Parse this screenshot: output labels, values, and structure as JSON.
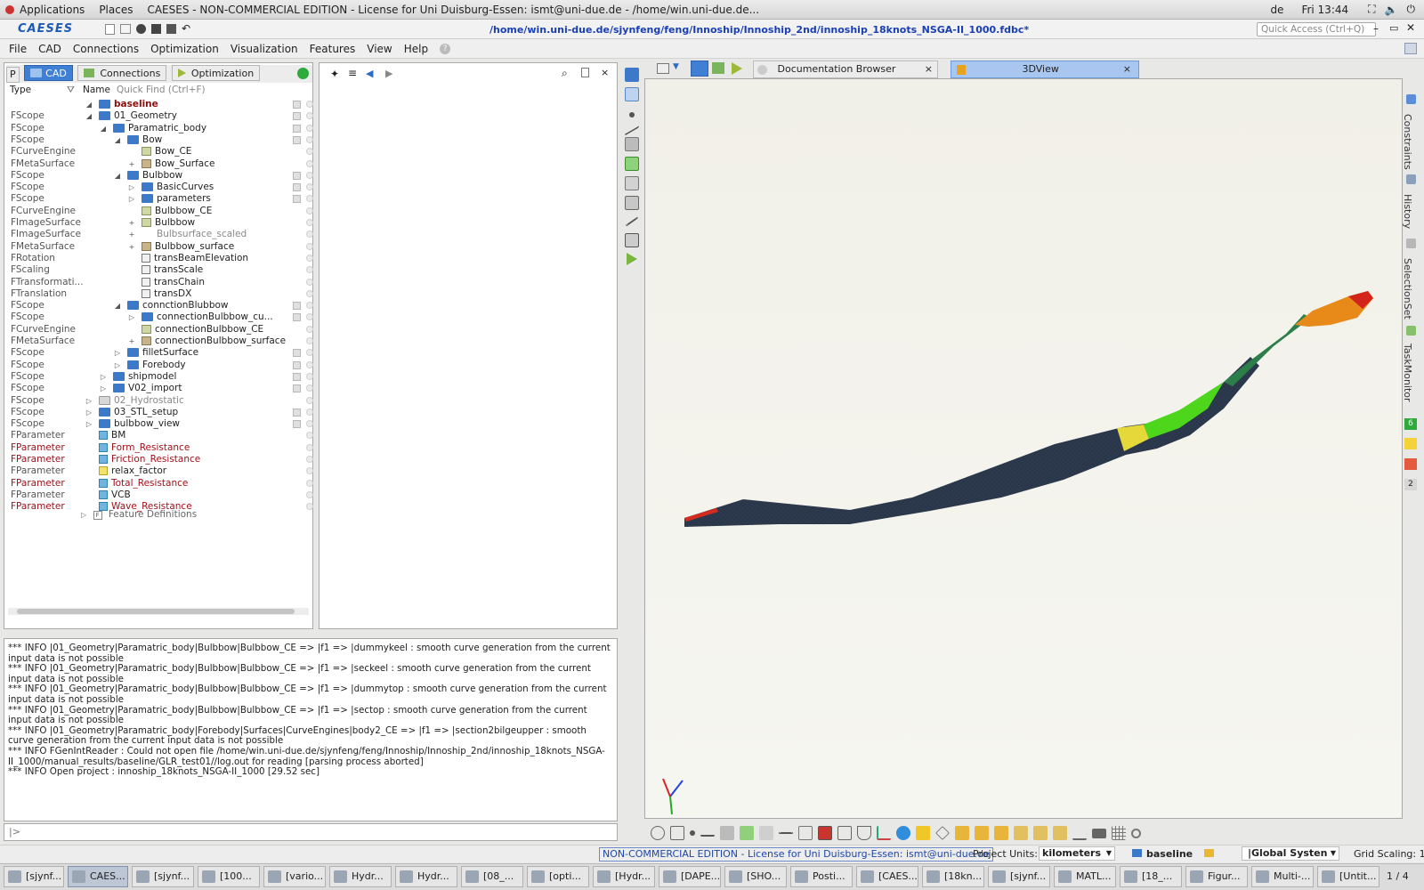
{
  "topbar": {
    "applications": "Applications",
    "places": "Places",
    "window_title": "CAESES - NON-COMMERCIAL EDITION - License for Uni Duisburg-Essen: ismt@uni-due.de - /home/win.uni-due.de...",
    "keyboard": "de",
    "clock": "Fri 13:44"
  },
  "app": {
    "logo": "CAESES",
    "file_path": "/home/win.uni-due.de/sjynfeng/feng/Innoship/Innoship_2nd/innoship_18knots_NSGA-II_1000.fdbc*",
    "quick_access_placeholder": "Quick Access (Ctrl+Q)"
  },
  "menu": [
    "File",
    "CAD",
    "Connections",
    "Optimization",
    "Visualization",
    "Features",
    "View",
    "Help"
  ],
  "left_tabs": {
    "p": "P",
    "cad": "CAD",
    "connections": "Connections",
    "optimization": "Optimization"
  },
  "tree_header": {
    "type": "Type",
    "name": "Name",
    "quickfind_placeholder": "Quick Find (Ctrl+F)"
  },
  "tree": [
    {
      "type": "",
      "name": "baseline",
      "style": "bold",
      "indent": 110,
      "fold": "◢",
      "icon": "folder"
    },
    {
      "type": "FScope",
      "name": "01_Geometry",
      "indent": 110,
      "fold": "◢",
      "icon": "folder"
    },
    {
      "type": "FScope",
      "name": "Paramatric_body",
      "indent": 126,
      "fold": "◢",
      "icon": "folder"
    },
    {
      "type": "FScope",
      "name": "Bow",
      "indent": 142,
      "fold": "◢",
      "icon": "folder"
    },
    {
      "type": "FCurveEngine",
      "name": "Bow_CE",
      "indent": 158,
      "fold": "",
      "icon": "curve"
    },
    {
      "type": "FMetaSurface",
      "name": "Bow_Surface",
      "indent": 158,
      "fold": "+",
      "icon": "surf"
    },
    {
      "type": "FScope",
      "name": "Bulbbow",
      "indent": 142,
      "fold": "◢",
      "icon": "folder"
    },
    {
      "type": "FScope",
      "name": "BasicCurves",
      "indent": 158,
      "fold": "▷",
      "icon": "folder"
    },
    {
      "type": "FScope",
      "name": "parameters",
      "indent": 158,
      "fold": "▷",
      "icon": "folder"
    },
    {
      "type": "FCurveEngine",
      "name": "Bulbbow_CE",
      "indent": 158,
      "fold": "",
      "icon": "curve"
    },
    {
      "type": "FImageSurface",
      "name": "Bulbbow",
      "indent": 158,
      "fold": "+",
      "icon": "curve"
    },
    {
      "type": "FImageSurface",
      "name": "Bulbsurface_scaled",
      "style": "grey",
      "indent": 158,
      "fold": "+",
      "icon": "none"
    },
    {
      "type": "FMetaSurface",
      "name": "Bulbbow_surface",
      "indent": 158,
      "fold": "+",
      "icon": "surf"
    },
    {
      "type": "FRotation",
      "name": "transBeamElevation",
      "indent": 158,
      "fold": "",
      "icon": "transf"
    },
    {
      "type": "FScaling",
      "name": "transScale",
      "indent": 158,
      "fold": "",
      "icon": "transf"
    },
    {
      "type": "FTransformati...",
      "name": "transChain",
      "indent": 158,
      "fold": "",
      "icon": "transf"
    },
    {
      "type": "FTranslation",
      "name": "transDX",
      "indent": 158,
      "fold": "",
      "icon": "transf"
    },
    {
      "type": "FScope",
      "name": "connctionBlubbow",
      "indent": 142,
      "fold": "◢",
      "icon": "folder"
    },
    {
      "type": "FScope",
      "name": "connectionBulbbow_cu...",
      "indent": 158,
      "fold": "▷",
      "icon": "folder"
    },
    {
      "type": "FCurveEngine",
      "name": "connectionBulbbow_CE",
      "indent": 158,
      "fold": "",
      "icon": "curve"
    },
    {
      "type": "FMetaSurface",
      "name": "connectionBulbbow_surface",
      "indent": 158,
      "fold": "+",
      "icon": "surf"
    },
    {
      "type": "FScope",
      "name": "filletSurface",
      "indent": 142,
      "fold": "▷",
      "icon": "folder"
    },
    {
      "type": "FScope",
      "name": "Forebody",
      "indent": 142,
      "fold": "▷",
      "icon": "folder"
    },
    {
      "type": "FScope",
      "name": "shipmodel",
      "indent": 126,
      "fold": "▷",
      "icon": "folder"
    },
    {
      "type": "FScope",
      "name": "V02_import",
      "indent": 126,
      "fold": "▷",
      "icon": "folder"
    },
    {
      "type": "FScope",
      "name": "02_Hydrostatic",
      "style": "grey",
      "indent": 110,
      "fold": "▷",
      "icon": "folder-grey"
    },
    {
      "type": "FScope",
      "name": "03_STL_setup",
      "indent": 110,
      "fold": "▷",
      "icon": "folder"
    },
    {
      "type": "FScope",
      "name": "bulbbow_view",
      "indent": 110,
      "fold": "▷",
      "icon": "folder"
    },
    {
      "type": "FParameter",
      "name": "BM",
      "indent": 110,
      "fold": "",
      "icon": "param"
    },
    {
      "type": "FParameter",
      "typestyle": "red",
      "name": "Form_Resistance",
      "style": "red",
      "indent": 110,
      "fold": "",
      "icon": "param"
    },
    {
      "type": "FParameter",
      "typestyle": "red",
      "name": "Friction_Resistance",
      "style": "red",
      "indent": 110,
      "fold": "",
      "icon": "param"
    },
    {
      "type": "FParameter",
      "name": "relax_factor",
      "indent": 110,
      "fold": "",
      "icon": "param-y"
    },
    {
      "type": "FParameter",
      "typestyle": "red",
      "name": "Total_Resistance",
      "style": "red",
      "indent": 110,
      "fold": "",
      "icon": "param"
    },
    {
      "type": "FParameter",
      "name": "VCB",
      "indent": 110,
      "fold": "",
      "icon": "param"
    },
    {
      "type": "FParameter",
      "typestyle": "red",
      "name": "Wave_Resistance",
      "style": "red",
      "indent": 110,
      "fold": "",
      "icon": "param"
    }
  ],
  "feature_definitions": "Feature Definitions",
  "view_tabs": {
    "documentation": "Documentation Browser",
    "view3d": "3DView"
  },
  "side_tabs": [
    "Constraints",
    "History",
    "SelectionSet",
    "TaskMonitor"
  ],
  "side_badges": [
    "6",
    "2"
  ],
  "console": [
    "*** INFO |01_Geometry|Paramatric_body|Bulbbow|Bulbbow_CE => |f1 => |dummykeel : smooth curve generation from the current input data is not possible",
    "*** INFO |01_Geometry|Paramatric_body|Bulbbow|Bulbbow_CE => |f1 => |seckeel : smooth curve generation from the current input data is not possible",
    "*** INFO |01_Geometry|Paramatric_body|Bulbbow|Bulbbow_CE => |f1 => |dummytop : smooth curve generation from the current input data is not possible",
    "*** INFO |01_Geometry|Paramatric_body|Bulbbow|Bulbbow_CE => |f1 => |sectop : smooth curve generation from the current input data is not possible",
    "*** INFO |01_Geometry|Paramatric_body|Forebody|Surfaces|CurveEngines|body2_CE => |f1 => |section2bilgeupper : smooth curve generation from the current input data is not possible",
    "*** INFO FGenIntReader : Could not open file /home/win.uni-due.de/sjynfeng/feng/Innoship/Innoship_2nd/innoship_18knots_NSGA-II_1000/manual_results/baseline/GLR_test01//log.out for reading [parsing process aborted]",
    "*** INFO Open project : innoship_18knots_NSGA-II_1000 [29.52 sec]"
  ],
  "console_prompt": "|>",
  "status": {
    "license": "NON-COMMERCIAL EDITION - License for Uni Duisburg-Essen: ismt@uni-due.de",
    "project_units_label": "Project Units:",
    "project_units_value": "kilometers",
    "scope": "baseline",
    "coord_system": "|Global Systen",
    "grid_scaling": "Grid Scaling: 1"
  },
  "taskbar": [
    "[sjynf...",
    "CAES...",
    "[sjynf...",
    "[100...",
    "[vario...",
    "Hydr...",
    "Hydr...",
    "[08_...",
    "[opti...",
    "[Hydr...",
    "[DAPE...",
    "[SHO...",
    "Posti...",
    "[CAES...",
    "[18kn...",
    "[sjynf...",
    "MATL...",
    "[18_...",
    "Figur...",
    "Multi-...",
    "[Untit..."
  ],
  "workspace_pager": "1 / 4",
  "colors": {
    "accent": "#3f7fd4",
    "path_blue": "#1a3fb5",
    "red_text": "#a0101a",
    "hull_dark": "#2d3a4e"
  }
}
